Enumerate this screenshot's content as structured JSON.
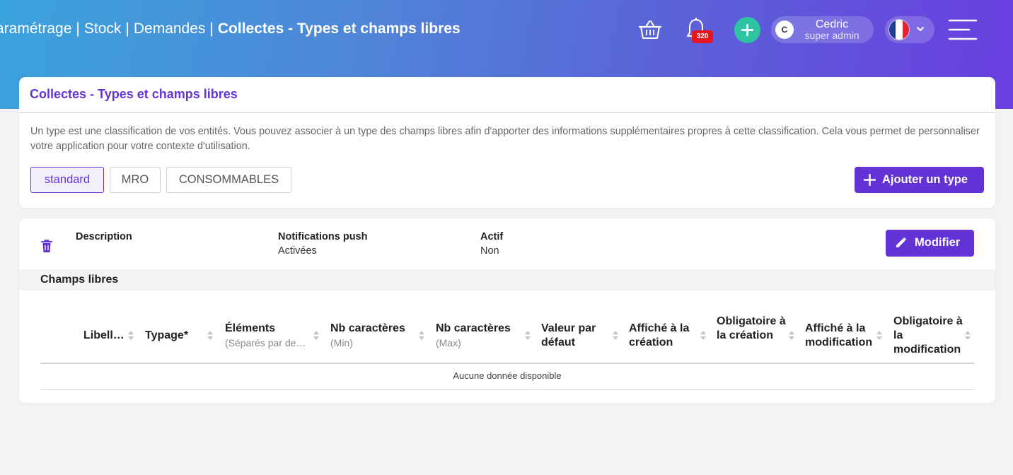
{
  "header": {
    "breadcrumb": [
      "aramétrage",
      "Stock",
      "Demandes"
    ],
    "breadcrumb_sep": "|",
    "breadcrumb_current": "Collectes - Types et champs libres",
    "notifications_count": "320",
    "user": {
      "initial": "C",
      "name": "Cedric",
      "role": "super admin"
    },
    "language_flag": "fr-flag-icon",
    "accent_color": "#6433d6",
    "add_button_color": "#2ec4a1"
  },
  "types_card": {
    "title": "Collectes - Types et champs libres",
    "description": "Un type est une classification de vos entités. Vous pouvez associer à un type des champs libres afin d'apporter des informations supplémentaires propres à cette classification. Cela vous permet de personnaliser votre application pour votre contexte d'utilisation.",
    "tabs": [
      {
        "label": "standard",
        "active": true
      },
      {
        "label": "MRO",
        "active": false
      },
      {
        "label": "CONSOMMABLES",
        "active": false
      }
    ],
    "add_type_label": "Ajouter un type"
  },
  "type_detail": {
    "fields": [
      {
        "label": "Description",
        "value": ""
      },
      {
        "label": "Notifications push",
        "value": "Activées"
      },
      {
        "label": "Actif",
        "value": "Non"
      }
    ],
    "edit_label": "Modifier",
    "section_title": "Champs libres",
    "columns": [
      {
        "label": "Libell…",
        "sub": ""
      },
      {
        "label": "Typage*",
        "sub": ""
      },
      {
        "label": "Éléments",
        "sub": "(Séparés par de…"
      },
      {
        "label": "Nb caractères",
        "sub": "(Min)"
      },
      {
        "label": "Nb caractères",
        "sub": "(Max)"
      },
      {
        "label": "Valeur par défaut",
        "sub": ""
      },
      {
        "label": "Affiché à la création",
        "sub": ""
      },
      {
        "label": "Obligatoire à la création",
        "sub": ""
      },
      {
        "label": "Affiché à la modification",
        "sub": ""
      },
      {
        "label": "Obligatoire à la modification",
        "sub": ""
      }
    ],
    "empty_message": "Aucune donnée disponible"
  }
}
